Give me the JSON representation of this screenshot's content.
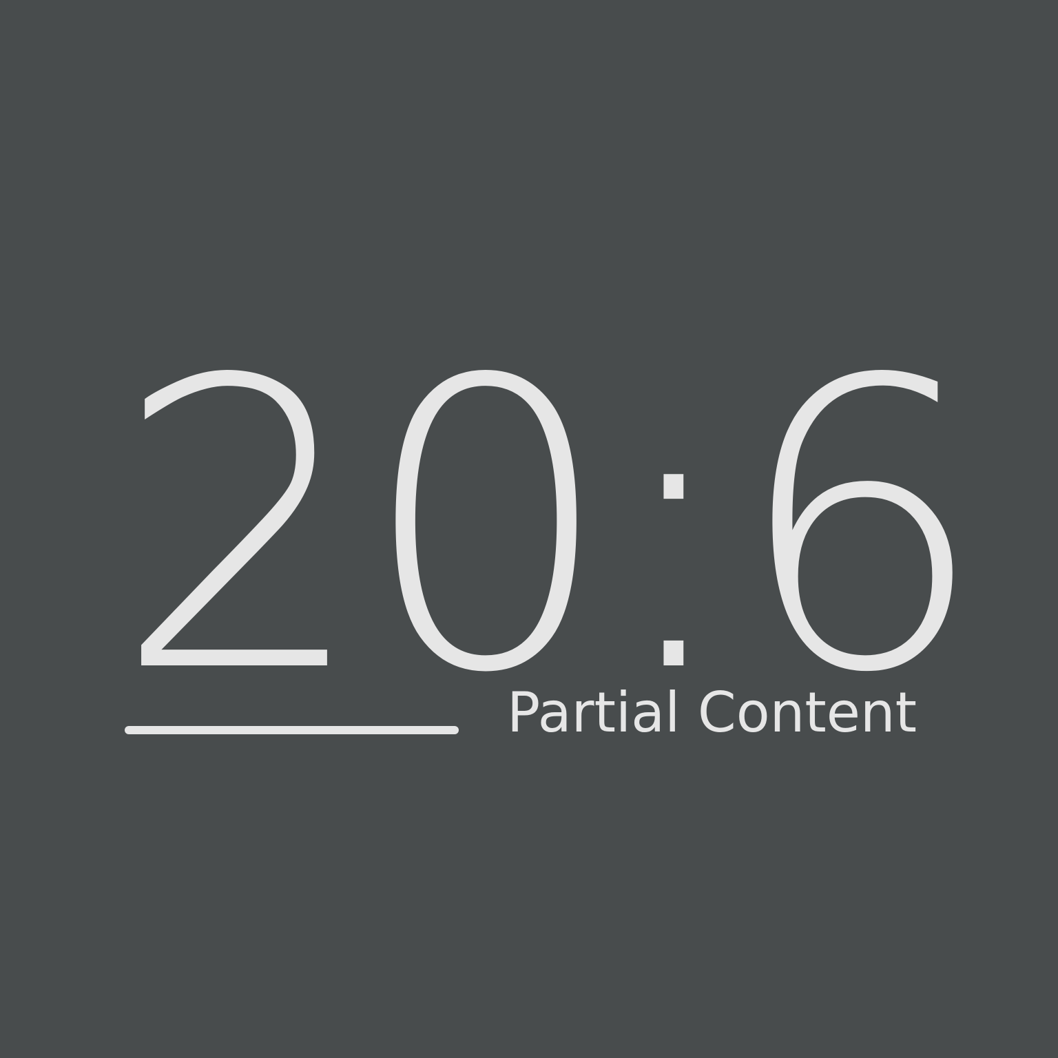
{
  "status": {
    "code": "20:6",
    "message": "Partial Content"
  }
}
